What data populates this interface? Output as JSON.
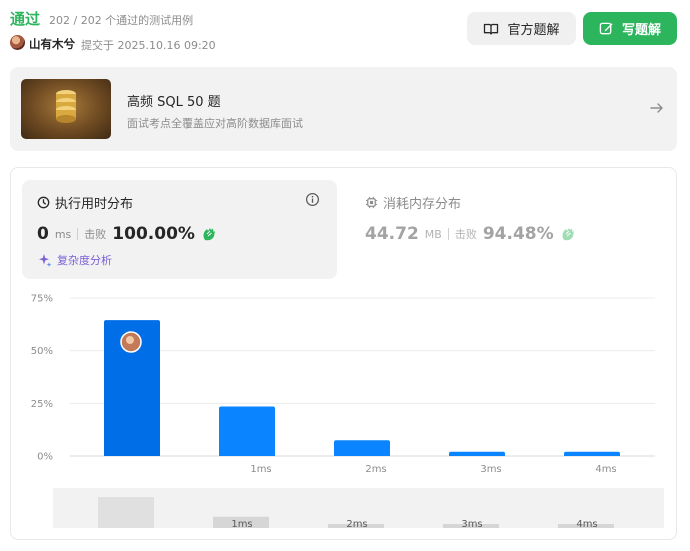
{
  "header": {
    "status": "通过",
    "cases": "202 / 202 个通过的测试用例",
    "user": "山有木兮",
    "submitted": "提交于 2025.10.16 09:20",
    "official_button": "官方题解",
    "write_button": "写题解"
  },
  "banner": {
    "title": "高频 SQL 50 题",
    "subtitle": "面试考点全覆盖应对高阶数据库面试",
    "icon": "arrow-right-icon"
  },
  "runtime": {
    "title": "执行用时分布",
    "value": "0",
    "unit": "ms",
    "beats_label": "击败",
    "beats_value": "100.00%",
    "complexity_link": "复杂度分析"
  },
  "memory": {
    "title": "消耗内存分布",
    "value": "44.72",
    "unit": "MB",
    "beats_label": "击败",
    "beats_value": "94.48%"
  },
  "colors": {
    "accent_green": "#2db55d",
    "bar_selected": "#006ee6",
    "bar": "#0a84ff",
    "complexity": "#7b5fd6"
  },
  "chart_data": {
    "type": "bar",
    "categories": [
      "0ms",
      "1ms",
      "2ms",
      "3ms",
      "4ms"
    ],
    "x_tick_labels": [
      "",
      "1ms",
      "2ms",
      "3ms",
      "4ms"
    ],
    "values": [
      64.5,
      23.5,
      7.5,
      2,
      2
    ],
    "y_ticks": [
      "0%",
      "25%",
      "50%",
      "75%"
    ],
    "ylim": [
      0,
      75
    ],
    "highlighted_category": "0ms",
    "grid": true,
    "navigator_labels": [
      "1ms",
      "2ms",
      "3ms",
      "4ms"
    ]
  }
}
